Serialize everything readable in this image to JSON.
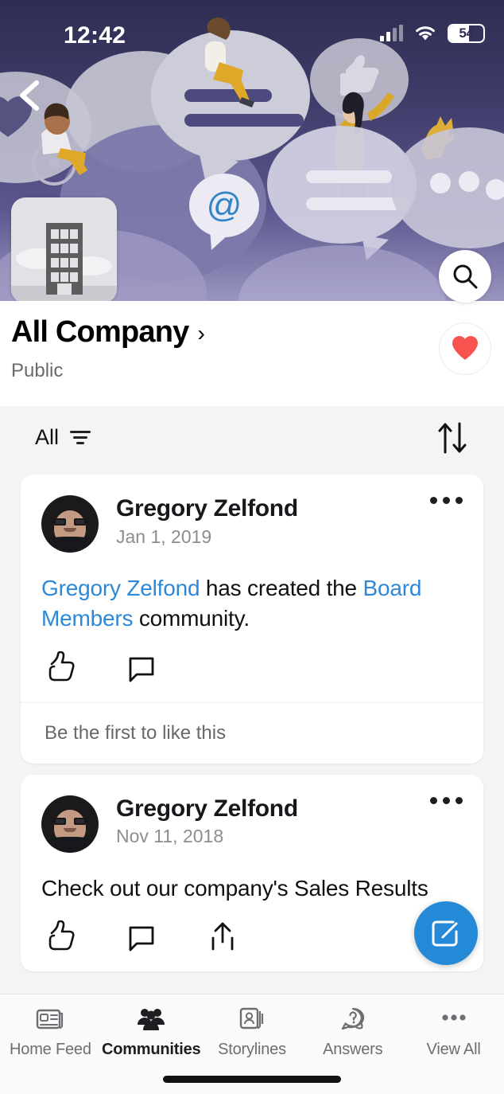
{
  "status_bar": {
    "time": "12:42",
    "battery_level": "54",
    "signal_icon": "cellular-signal-icon",
    "wifi_icon": "wifi-icon",
    "battery_icon": "battery-icon"
  },
  "banner": {
    "back_icon": "back-chevron-icon",
    "search_icon": "search-icon",
    "favorite_icon": "heart-icon",
    "favorite_color": "#f9534f",
    "community_avatar_icon": "office-building-icon",
    "illustration": "people-and-speech-bubbles-illustration",
    "mention_glyph": "@"
  },
  "header": {
    "title": "All Company",
    "title_chevron": "›",
    "privacy": "Public"
  },
  "filter_bar": {
    "filter_label": "All",
    "filter_icon": "filter-icon",
    "sort_icon": "sort-arrows-icon"
  },
  "feed": {
    "posts": [
      {
        "author": "Gregory Zelfond",
        "date": "Jan 1, 2019",
        "avatar": "user-avatar",
        "more_icon": "more-options-icon",
        "body_parts": [
          {
            "text": "Gregory Zelfond",
            "link": true
          },
          {
            "text": " has created the ",
            "link": false
          },
          {
            "text": "Board Members",
            "link": true
          },
          {
            "text": " community.",
            "link": false
          }
        ],
        "actions": [
          "like-icon",
          "comment-icon"
        ],
        "footer": "Be the first to like this"
      },
      {
        "author": "Gregory Zelfond",
        "date": "Nov 11, 2018",
        "avatar": "user-avatar",
        "more_icon": "more-options-icon",
        "body_text": "Check out our company's Sales Results",
        "actions": [
          "like-icon",
          "comment-icon",
          "share-icon"
        ]
      }
    ]
  },
  "compose_fab": {
    "icon": "compose-icon",
    "color": "#2489d6"
  },
  "bottom_nav": {
    "items": [
      {
        "label": "Home Feed",
        "icon": "newspaper-icon",
        "active": false
      },
      {
        "label": "Communities",
        "icon": "people-group-icon",
        "active": true
      },
      {
        "label": "Storylines",
        "icon": "id-card-icon",
        "active": false
      },
      {
        "label": "Answers",
        "icon": "question-bubble-icon",
        "active": false
      },
      {
        "label": "View All",
        "icon": "ellipsis-icon",
        "active": false
      }
    ]
  },
  "colors": {
    "link": "#2e88d9",
    "accent": "#2489d6",
    "banner_top": "#2f2e52",
    "banner_bottom": "#8e8ab8"
  }
}
